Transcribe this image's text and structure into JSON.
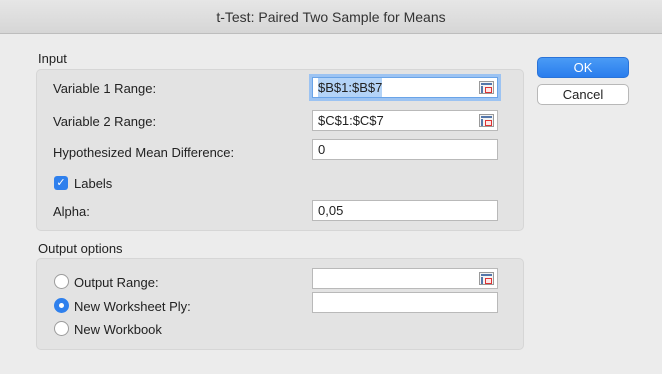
{
  "dialog": {
    "title": "t-Test: Paired Two Sample for Means"
  },
  "input": {
    "section_label": "Input",
    "variable1": {
      "label": "Variable 1 Range:",
      "value": "$B$1:$B$7"
    },
    "variable2": {
      "label": "Variable 2 Range:",
      "value": "$C$1:$C$7"
    },
    "mean_diff": {
      "label": "Hypothesized Mean Difference:",
      "value": "0"
    },
    "labels": {
      "label": "Labels",
      "checked": true
    },
    "alpha": {
      "label": "Alpha:",
      "value": "0,05"
    }
  },
  "output": {
    "section_label": "Output options",
    "options": [
      {
        "label": "Output Range:",
        "selected": false,
        "value": ""
      },
      {
        "label": "New Worksheet Ply:",
        "selected": true,
        "value": ""
      },
      {
        "label": "New Workbook",
        "selected": false
      }
    ]
  },
  "buttons": {
    "ok": "OK",
    "cancel": "Cancel"
  },
  "colors": {
    "accent": "#2f80ed",
    "group_bg": "#e3e3e3",
    "window_bg": "#ececec"
  },
  "icons": {
    "range_selector": "range-selector-icon",
    "checkmark": "checkmark-icon"
  }
}
